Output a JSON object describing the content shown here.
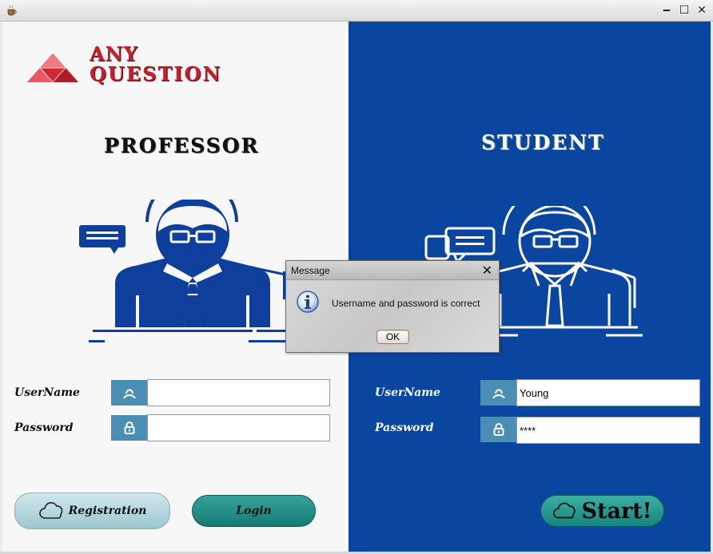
{
  "window": {
    "title": "",
    "minimize_glyph": "🗕",
    "maximize_glyph": "☐",
    "close_glyph": "✕"
  },
  "logo": {
    "line1": "ANY",
    "line2": "QUESTION"
  },
  "professor": {
    "heading": "PROFESSOR",
    "username_label": "UserName",
    "password_label": "Password",
    "username_value": "",
    "password_value": ""
  },
  "student": {
    "heading": "STUDENT",
    "username_label": "UserName",
    "password_label": "Password",
    "username_value": "Young",
    "password_value": "****"
  },
  "buttons": {
    "registration": "Registration",
    "login": "Login",
    "start": "Start!"
  },
  "dialog": {
    "title": "Message",
    "close_glyph": "✕",
    "message": "Username and password is correct",
    "ok_label": "OK"
  },
  "colors": {
    "left_panel": "#f7f7f7",
    "right_panel": "#0a46a0",
    "accent_red": "#c7202c",
    "icon_box": "#4a8fb3",
    "teal_button": "#137c75"
  },
  "icons": {
    "app": "coffee-cup-icon",
    "username": "user-icon",
    "password": "lock-icon",
    "cloud": "cloud-icon",
    "info": "info-icon"
  }
}
